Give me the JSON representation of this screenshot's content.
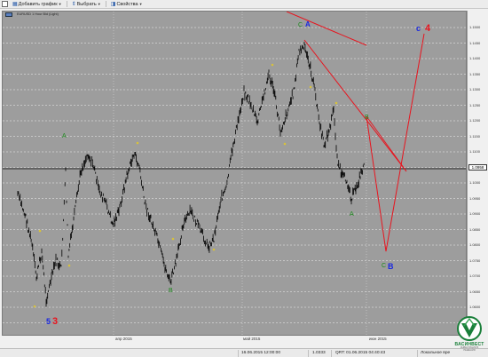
{
  "toolbar": {
    "add_chart": "Добавить график",
    "select": "Выбрать",
    "properties": "Свойства",
    "icons": [
      "window-icon",
      "tiles-icon",
      "pen-icon",
      "redo-icon",
      "chart-icon",
      "select-icon",
      "properties-icon"
    ]
  },
  "chart": {
    "title": "EURUSD 1 Hour Bid (Light)",
    "bg_color": "#9d9d9d",
    "price_ticks": [
      "1.1500",
      "1.1450",
      "1.1400",
      "1.1350",
      "1.1300",
      "1.1250",
      "1.1200",
      "1.1150",
      "1.1100",
      "1.1050",
      "1.1000",
      "1.0950",
      "1.0900",
      "1.0850",
      "1.0800",
      "1.0750",
      "1.0700",
      "1.0650",
      "1.0600",
      "1.0550"
    ],
    "current_price": "1.0958",
    "time_ticks": [
      "апр 2015",
      "май 2015",
      "июн 2015"
    ],
    "wave_labels": {
      "c_top_left": "C",
      "A_top": "A",
      "c_top_right": "c",
      "four": "4",
      "five": "5",
      "three": "3",
      "a_right": "a",
      "B_right": "B",
      "A_green_left": "A",
      "B_green": "B",
      "A_green_right": "A",
      "B_green_right": "B",
      "c_bottom": "C",
      "B_blue_bottom": "B"
    },
    "colors": {
      "candle": "#000000",
      "red_line": "#e8141e",
      "blue": "#1a28e0",
      "green": "#1b8a1b",
      "yellow": "#d8c23a"
    }
  },
  "status": {
    "datetime": "16.06.2015 12:00:00",
    "price": "1.0333",
    "server": "QRT: 01.06.2015 04:40:43",
    "local": "Локальное вре"
  },
  "logo": {
    "name": "ВАСИНВЕСТ",
    "tagline": "ИНВЕСТИЦИИ В РЕШЕНИЯ"
  }
}
